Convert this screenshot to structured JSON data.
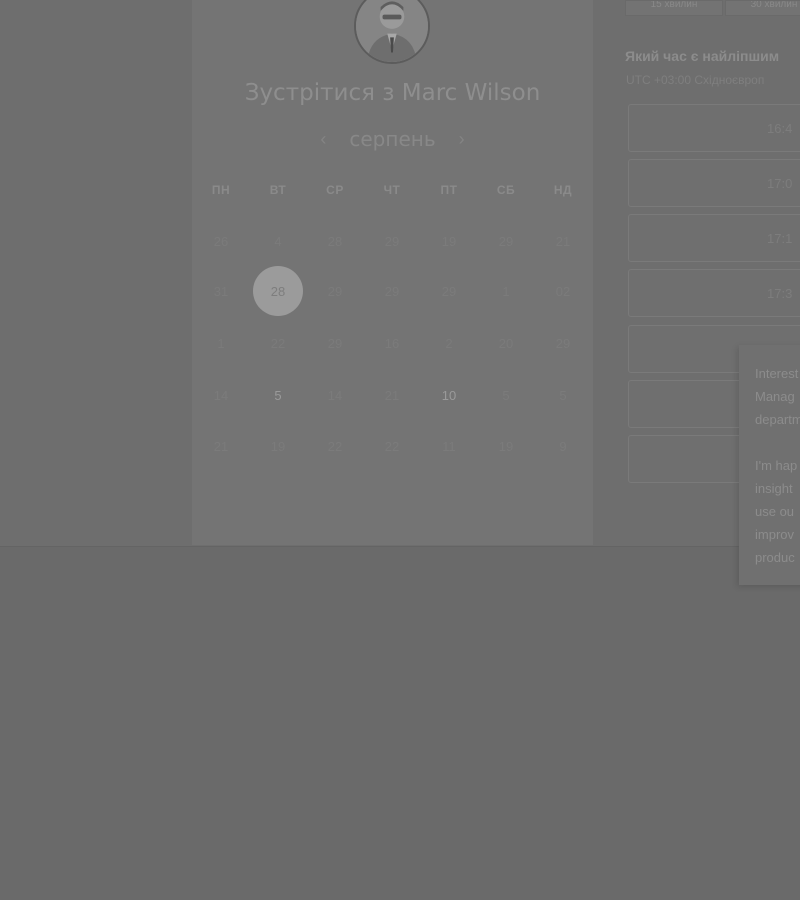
{
  "booking": {
    "title": "Зустрітися з Marc Wilson",
    "month": "серпень",
    "prev_icon": "‹",
    "next_icon": "›"
  },
  "weekdays": [
    "ПН",
    "ВТ",
    "СР",
    "ЧТ",
    "ПТ",
    "СБ",
    "НД"
  ],
  "calendar": {
    "rows": [
      [
        "26",
        "4",
        "28",
        "29",
        "19",
        "29",
        "21"
      ],
      [
        "31",
        "28",
        "29",
        "29",
        "29",
        "1",
        "02"
      ],
      [
        "1",
        "22",
        "29",
        "16",
        "2",
        "20",
        "29"
      ],
      [
        "14",
        "5",
        "14",
        "21",
        "10",
        "5",
        "5"
      ],
      [
        "21",
        "19",
        "22",
        "22",
        "11",
        "19",
        "9"
      ]
    ],
    "selected": "28",
    "active": [
      "5",
      "10"
    ]
  },
  "durations": [
    "15 хвилин",
    "30 хвилин"
  ],
  "time_panel": {
    "heading": "Який час є найліпшим",
    "timezone": "UTC +03:00 Східноєвроп",
    "slots": [
      "16:4",
      "17:0",
      "17:1",
      "17:3",
      "",
      "",
      ""
    ]
  },
  "popup": {
    "lines": [
      "Interest",
      "Manag",
      "departm",
      "",
      "I'm hap",
      "insight",
      "use ou",
      "improv",
      "produc"
    ]
  }
}
